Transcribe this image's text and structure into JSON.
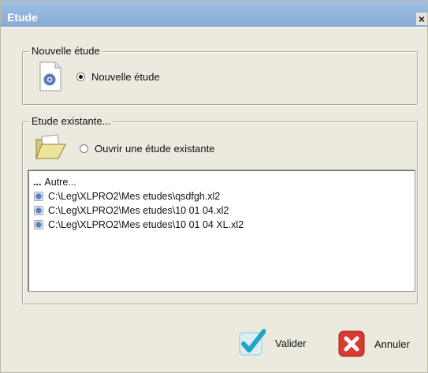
{
  "window": {
    "title": "Etude",
    "close_glyph": "×"
  },
  "new_study": {
    "group_label": "Nouvelle étude",
    "option_label": "Nouvelle étude",
    "selected": true,
    "icon": "study-file-icon"
  },
  "existing_study": {
    "group_label": "Etude existante...",
    "option_label": "Ouvrir une étude existante",
    "selected": false,
    "icon": "open-folder-icon"
  },
  "recent_files": {
    "other_prefix": "...",
    "other_label": "Autre...",
    "items": [
      "C:\\Leg\\XLPRO2\\Mes etudes\\qsdfgh.xl2",
      "C:\\Leg\\XLPRO2\\Mes etudes\\10 01 04.xl2",
      "C:\\Leg\\XLPRO2\\Mes etudes\\10 01 04 XL.xl2"
    ]
  },
  "buttons": {
    "validate_label": "Valider",
    "cancel_label": "Annuler"
  },
  "colors": {
    "titlebar": "#8fb3da",
    "validate_check": "#1fa4c9",
    "cancel_x": "#d83a2e"
  }
}
